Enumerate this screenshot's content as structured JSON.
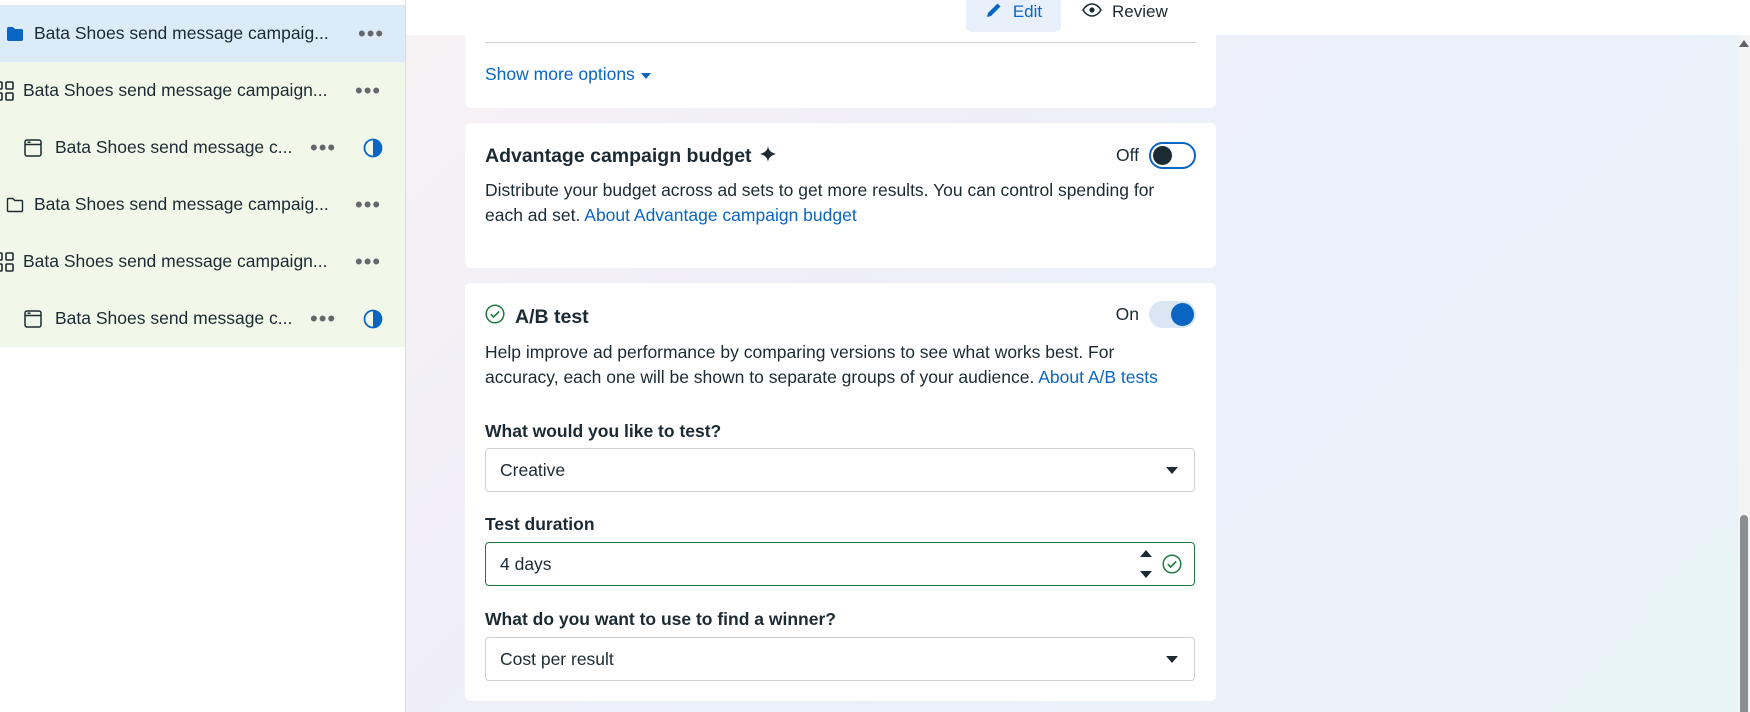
{
  "sidebar": {
    "items": [
      {
        "label": "Bata Shoes send message campaig...",
        "icon": "folder-filled-icon",
        "state": "selected"
      },
      {
        "label": "Bata Shoes send message campaign...",
        "icon": "grid-icon",
        "state": "normal"
      },
      {
        "label": "Bata Shoes send message c...",
        "icon": "ad-window-icon",
        "state": "normal"
      },
      {
        "label": "Bata Shoes send message campaig...",
        "icon": "folder-outline-icon",
        "state": "normal"
      },
      {
        "label": "Bata Shoes send message campaign...",
        "icon": "grid-icon",
        "state": "normal"
      },
      {
        "label": "Bata Shoes send message c...",
        "icon": "ad-window-icon",
        "state": "normal"
      }
    ],
    "more_glyph": "•••"
  },
  "topbar": {
    "edit_label": "Edit",
    "review_label": "Review"
  },
  "options_card": {
    "show_more_label": "Show more options"
  },
  "budget_card": {
    "title": "Advantage campaign budget",
    "toggle_label": "Off",
    "description": "Distribute your budget across ad sets to get more results. You can control spending for each ad set.",
    "link": "About Advantage campaign budget"
  },
  "ab_card": {
    "title": "A/B test",
    "toggle_label": "On",
    "description": "Help improve ad performance by comparing versions to see what works best. For accuracy, each one will be shown to separate groups of your audience.",
    "link": "About A/B tests",
    "test_label": "What would you like to test?",
    "test_value": "Creative",
    "duration_label": "Test duration",
    "duration_value": "4 days",
    "winner_label": "What do you want to use to find a winner?",
    "winner_value": "Cost per result"
  },
  "colors": {
    "accent": "#0a66c2",
    "selected_row": "#dcebf8",
    "green_row": "#f1f8e9",
    "valid_green": "#1f7a43"
  }
}
